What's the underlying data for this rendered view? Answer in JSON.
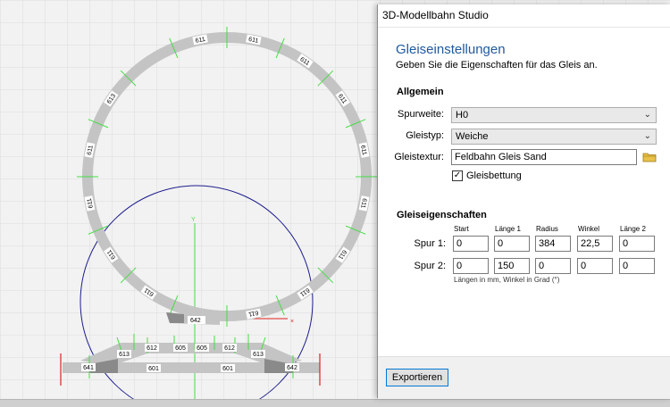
{
  "window": {
    "title": "3D-Modellbahn Studio"
  },
  "dialog": {
    "heading": "Gleiseinstellungen",
    "subtitle": "Geben Sie die Eigenschaften für das Gleis an.",
    "general": {
      "section_label": "Allgemein",
      "gauge_label": "Spurweite:",
      "gauge_value": "H0",
      "type_label": "Gleistyp:",
      "type_value": "Weiche",
      "texture_label": "Gleistextur:",
      "texture_value": "Feldbahn Gleis Sand",
      "bedding_label": "Gleisbettung",
      "bedding_checked": true
    },
    "properties": {
      "section_label": "Gleiseigenschaften",
      "columns": [
        "Start",
        "Länge 1",
        "Radius",
        "Winkel",
        "Länge 2"
      ],
      "rows": [
        {
          "label": "Spur 1:",
          "values": [
            "0",
            "0",
            "384",
            "22,5",
            "0"
          ]
        },
        {
          "label": "Spur 2:",
          "values": [
            "0",
            "150",
            "0",
            "0",
            "0"
          ]
        }
      ],
      "note": "Längen in mm, Winkel in Grad (°)"
    },
    "export_button": "Exportieren"
  },
  "canvas": {
    "axis_label": "Y",
    "close_marker": "×",
    "circle_labels": [
      "611",
      "611",
      "611",
      "611",
      "611",
      "611",
      "611",
      "611",
      "611",
      "611",
      "611",
      "611",
      "611",
      "613"
    ],
    "switch_label": "642",
    "bottom_labels": [
      "641",
      "613",
      "612",
      "605",
      "605",
      "612",
      "613",
      "642",
      "601",
      "601"
    ],
    "colors": {
      "track": "#c4c4c4",
      "marker": "#44dd44",
      "guide": "#1c1c8c",
      "endline": "#dd2222"
    }
  }
}
